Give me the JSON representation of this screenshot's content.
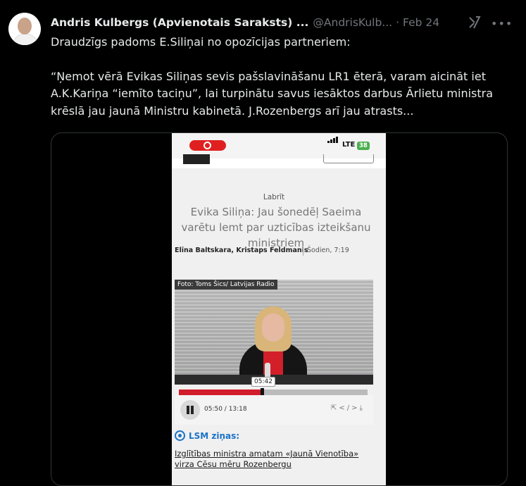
{
  "tweet": {
    "author_name": "Andris Kulbergs (Apvienotais Saraksts) ...",
    "handle": "@AndrisKulb...",
    "separator": "·",
    "date": "Feb 24",
    "more_label": "•••",
    "text_line_1": "Draudzīgs padoms E.Siliņai no opozīcijas partneriem:",
    "text_paragraph_2": "“Ņemot vērā Evikas Siliņas sevis pašslavināšanu LR1 ēterā, varam aicināt iet A.K.Kariņa “iemīto taciņu”, lai turpinātu savus iesāktos darbus Ārlietu ministra krēslā jau jaunā Ministru kabinetā. J.Rozenbergs arī jau atrasts..."
  },
  "video": {
    "status_bar": {
      "network": "LTE",
      "battery": "38"
    },
    "article": {
      "category": "Labrīt",
      "title": "Evika Siliņa: Jau šonedēļ Saeima varētu lemt par uzticības izteikšanu ministriem",
      "authors": "Elīna Baltskara, Kristaps Feldmanis",
      "time": "Šodien, 7:19"
    },
    "photo_caption": "Foto: Toms Šics/ Latvijas Radio",
    "player": {
      "tooltip": "05:42",
      "time_display": "05:50 / 13:18",
      "progress_fraction": 0.44,
      "icons": [
        "share-icon",
        "embed-icon",
        "download-icon"
      ]
    },
    "related": {
      "label": "LSM ziņas:",
      "link_text": "Izglītības ministra amatam «Jaunā Vienotība» virza Cēsu mēru Rozenbergu"
    }
  }
}
